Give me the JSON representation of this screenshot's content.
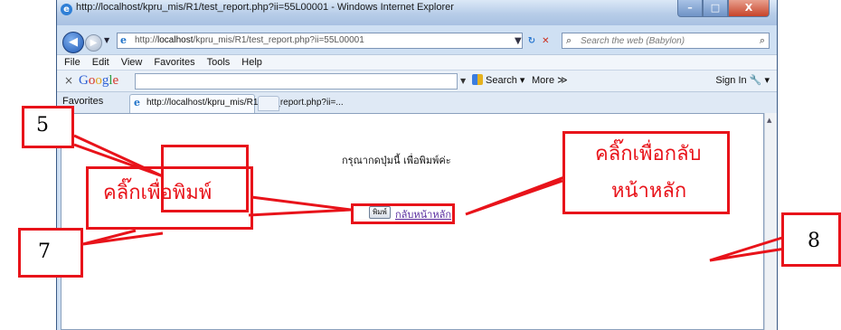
{
  "window": {
    "title": "http://localhost/kpru_mis/R1/test_report.php?ii=55L00001 - Windows Internet Explorer",
    "buttons": {
      "minimize": "–",
      "maximize": "□",
      "close": "X"
    }
  },
  "navigation": {
    "back_symbol": "◀",
    "forward_symbol": "▶",
    "address_prefix": "http://",
    "address_host": "localhost",
    "address_path": "/kpru_mis/R1/test_report.php?ii=55L00001",
    "refresh_symbol": "↻",
    "stop_symbol": "✕",
    "search_placeholder": "Search the web (Babylon)"
  },
  "menu": [
    "File",
    "Edit",
    "View",
    "Favorites",
    "Tools",
    "Help"
  ],
  "google_toolbar": {
    "close": "×",
    "logo": [
      "G",
      "o",
      "o",
      "g",
      "l",
      "e"
    ],
    "search_label": "Search",
    "more_label": "More ≫",
    "sign_in": "Sign In"
  },
  "favorites_bar": {
    "label": "Favorites",
    "tab_title": "http://localhost/kpru_mis/R1/test_report.php?ii=..."
  },
  "page": {
    "prompt": "กรุณากดปุ่มนี้ เพื่อพิมพ์ค่ะ",
    "print_button": "พิมพ์",
    "home_link": "กลับหน้าหลัก"
  },
  "annotations": {
    "callout_5": "5",
    "callout_7": "7",
    "callout_8": "8",
    "print_label": "คลิ๊กเพื่อพิมพ์",
    "back_label_line1": "คลิ๊กเพื่อกลับ",
    "back_label_line2": "หน้าหลัก",
    "color": "#e8131a"
  }
}
